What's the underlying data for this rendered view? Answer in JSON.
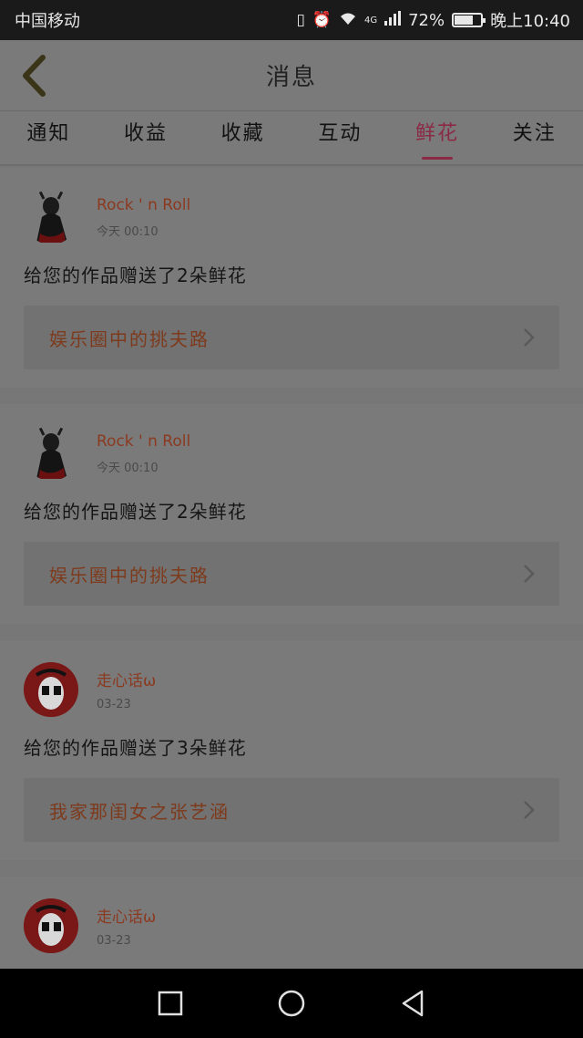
{
  "status_bar": {
    "carrier": "中国移动",
    "network": "4G",
    "battery_percent": "72%",
    "battery_level": 0.72,
    "time": "晚上10:40",
    "icons": [
      "vibrate-icon",
      "alarm-icon",
      "wifi-icon",
      "signal-icon",
      "battery-icon"
    ]
  },
  "header": {
    "title": "消息",
    "back_icon": "chevron-left-icon"
  },
  "tabs": [
    {
      "label": "通知",
      "active": false
    },
    {
      "label": "收益",
      "active": false
    },
    {
      "label": "收藏",
      "active": false
    },
    {
      "label": "互动",
      "active": false
    },
    {
      "label": "鲜花",
      "active": true
    },
    {
      "label": "关注",
      "active": false
    }
  ],
  "messages": [
    {
      "username": "Rock ' n Roll",
      "time": "今天 00:10",
      "text": "给您的作品赠送了2朵鲜花",
      "work_title": "娱乐圈中的挑夫路",
      "avatar_style": "dark"
    },
    {
      "username": "Rock ' n Roll",
      "time": "今天 00:10",
      "text": "给您的作品赠送了2朵鲜花",
      "work_title": "娱乐圈中的挑夫路",
      "avatar_style": "dark"
    },
    {
      "username": "走心话ω",
      "time": "03-23",
      "text": "给您的作品赠送了3朵鲜花",
      "work_title": "我家那闺女之张艺涵",
      "avatar_style": "red"
    },
    {
      "username": "走心话ω",
      "time": "03-23",
      "text": "",
      "work_title": "",
      "avatar_style": "red"
    }
  ],
  "nav": [
    "square-icon",
    "circle-icon",
    "back-triangle-icon"
  ],
  "colors": {
    "accent": "#8a2a45",
    "username": "#8b3a20",
    "overlay_bg": "#7a7a7a"
  }
}
